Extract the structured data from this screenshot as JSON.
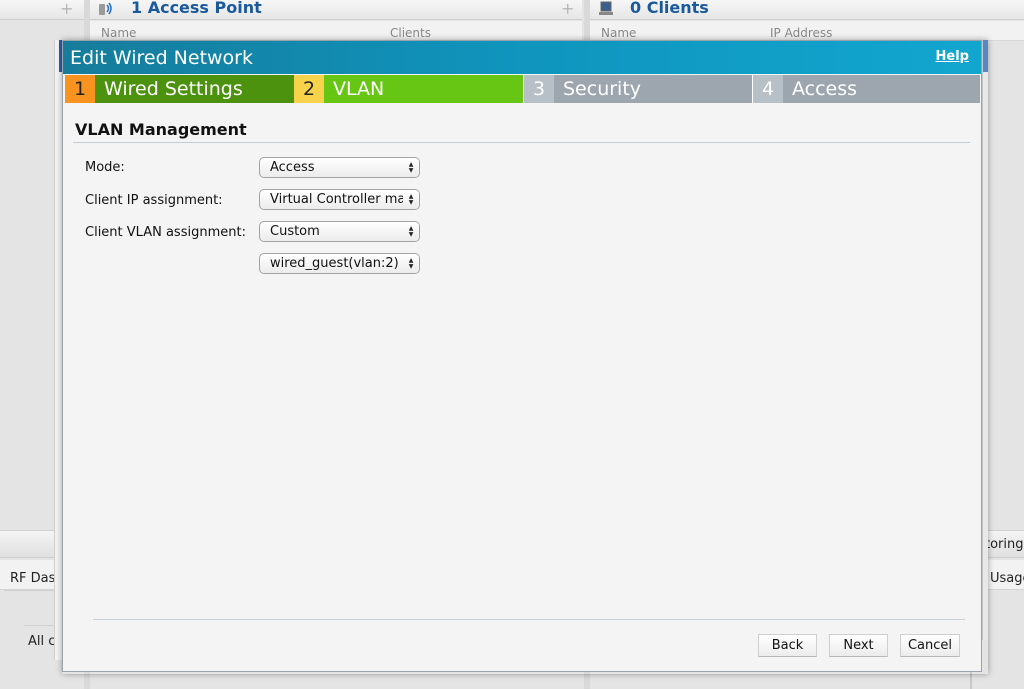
{
  "background": {
    "panels": [
      {
        "title": "1 Access Point",
        "icon": "access-point-icon",
        "columns": [
          "Name",
          "Clients"
        ]
      },
      {
        "title": "0 Clients",
        "icon": "laptop-icon",
        "columns": [
          "Name",
          "IP Address"
        ]
      }
    ],
    "add_symbol": "+",
    "sort_symbol": "—",
    "bottom_left_tab": "RF Das",
    "bottom_left_filter": "All cl",
    "bottom_right_tab": "toring",
    "bottom_right_tab2": "Usage"
  },
  "modal": {
    "title": "Edit Wired Network",
    "help_label": "Help",
    "steps": [
      {
        "num": "1",
        "label": "Wired Settings",
        "state": "completed"
      },
      {
        "num": "2",
        "label": "VLAN",
        "state": "active"
      },
      {
        "num": "3",
        "label": "Security",
        "state": "pending"
      },
      {
        "num": "4",
        "label": "Access",
        "state": "pending"
      }
    ],
    "section_title": "VLAN Management",
    "fields": [
      {
        "label": "Mode:",
        "value": "Access"
      },
      {
        "label": "Client IP assignment:",
        "value": "Virtual Controller managed"
      },
      {
        "label": "Client VLAN assignment:",
        "value": "Custom"
      },
      {
        "label": "",
        "value": "wired_guest(vlan:2)"
      }
    ],
    "buttons": {
      "back": "Back",
      "next": "Next",
      "cancel": "Cancel"
    }
  },
  "colors": {
    "header": "#0f95be",
    "step_completed": "#4c920f",
    "step_active": "#66c613",
    "step_pending": "#9da6ae",
    "title_link": "#1a5a9c"
  }
}
